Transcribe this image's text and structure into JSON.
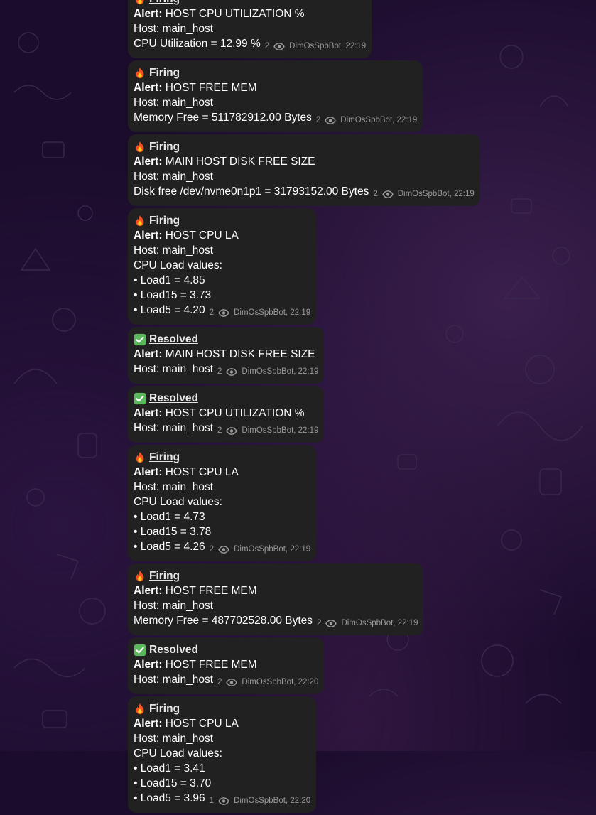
{
  "labels": {
    "alert": "Alert:"
  },
  "messages": [
    {
      "status": "Firing",
      "status_icon": "fire-icon",
      "alert": "HOST CPU UTILIZATION %",
      "lines": [
        "Host: main_host",
        "CPU Utilization = 12.99 %"
      ],
      "views": "2",
      "author_time": "DimOsSpbBot, 22:19"
    },
    {
      "status": "Firing",
      "status_icon": "fire-icon",
      "alert": "HOST FREE MEM",
      "lines": [
        "Host: main_host",
        "Memory Free = 511782912.00 Bytes"
      ],
      "views": "2",
      "author_time": "DimOsSpbBot, 22:19"
    },
    {
      "status": "Firing",
      "status_icon": "fire-icon",
      "alert": "MAIN HOST DISK FREE SIZE",
      "lines": [
        "Host: main_host",
        "Disk free /dev/nvme0n1p1 = 31793152.00 Bytes"
      ],
      "views": "2",
      "author_time": "DimOsSpbBot, 22:19"
    },
    {
      "status": "Firing",
      "status_icon": "fire-icon",
      "alert": "HOST CPU LA",
      "lines": [
        "Host: main_host",
        "CPU Load values:",
        "• Load1 = 4.85",
        "• Load15 = 3.73",
        "• Load5 = 4.20"
      ],
      "views": "2",
      "author_time": "DimOsSpbBot, 22:19"
    },
    {
      "status": "Resolved",
      "status_icon": "check-mark-icon",
      "alert": "MAIN HOST DISK FREE SIZE",
      "lines": [
        "Host: main_host"
      ],
      "views": "2",
      "author_time": "DimOsSpbBot, 22:19"
    },
    {
      "status": "Resolved",
      "status_icon": "check-mark-icon",
      "alert": "HOST CPU UTILIZATION %",
      "lines": [
        "Host: main_host"
      ],
      "views": "2",
      "author_time": "DimOsSpbBot, 22:19"
    },
    {
      "status": "Firing",
      "status_icon": "fire-icon",
      "alert": "HOST CPU LA",
      "lines": [
        "Host: main_host",
        "CPU Load values:",
        "• Load1 = 4.73",
        "• Load15 = 3.78",
        "• Load5 = 4.26"
      ],
      "views": "2",
      "author_time": "DimOsSpbBot, 22:19"
    },
    {
      "status": "Firing",
      "status_icon": "fire-icon",
      "alert": "HOST FREE MEM",
      "lines": [
        "Host: main_host",
        "Memory Free = 487702528.00 Bytes"
      ],
      "views": "2",
      "author_time": "DimOsSpbBot, 22:19"
    },
    {
      "status": "Resolved",
      "status_icon": "check-mark-icon",
      "alert": "HOST FREE MEM",
      "lines": [
        "Host: main_host"
      ],
      "views": "2",
      "author_time": "DimOsSpbBot, 22:20"
    },
    {
      "status": "Firing",
      "status_icon": "fire-icon",
      "alert": "HOST CPU LA",
      "lines": [
        "Host: main_host",
        "CPU Load values:",
        "• Load1 = 3.41",
        "• Load15 = 3.70",
        "• Load5 = 3.96"
      ],
      "views": "1",
      "author_time": "DimOsSpbBot, 22:20"
    }
  ]
}
